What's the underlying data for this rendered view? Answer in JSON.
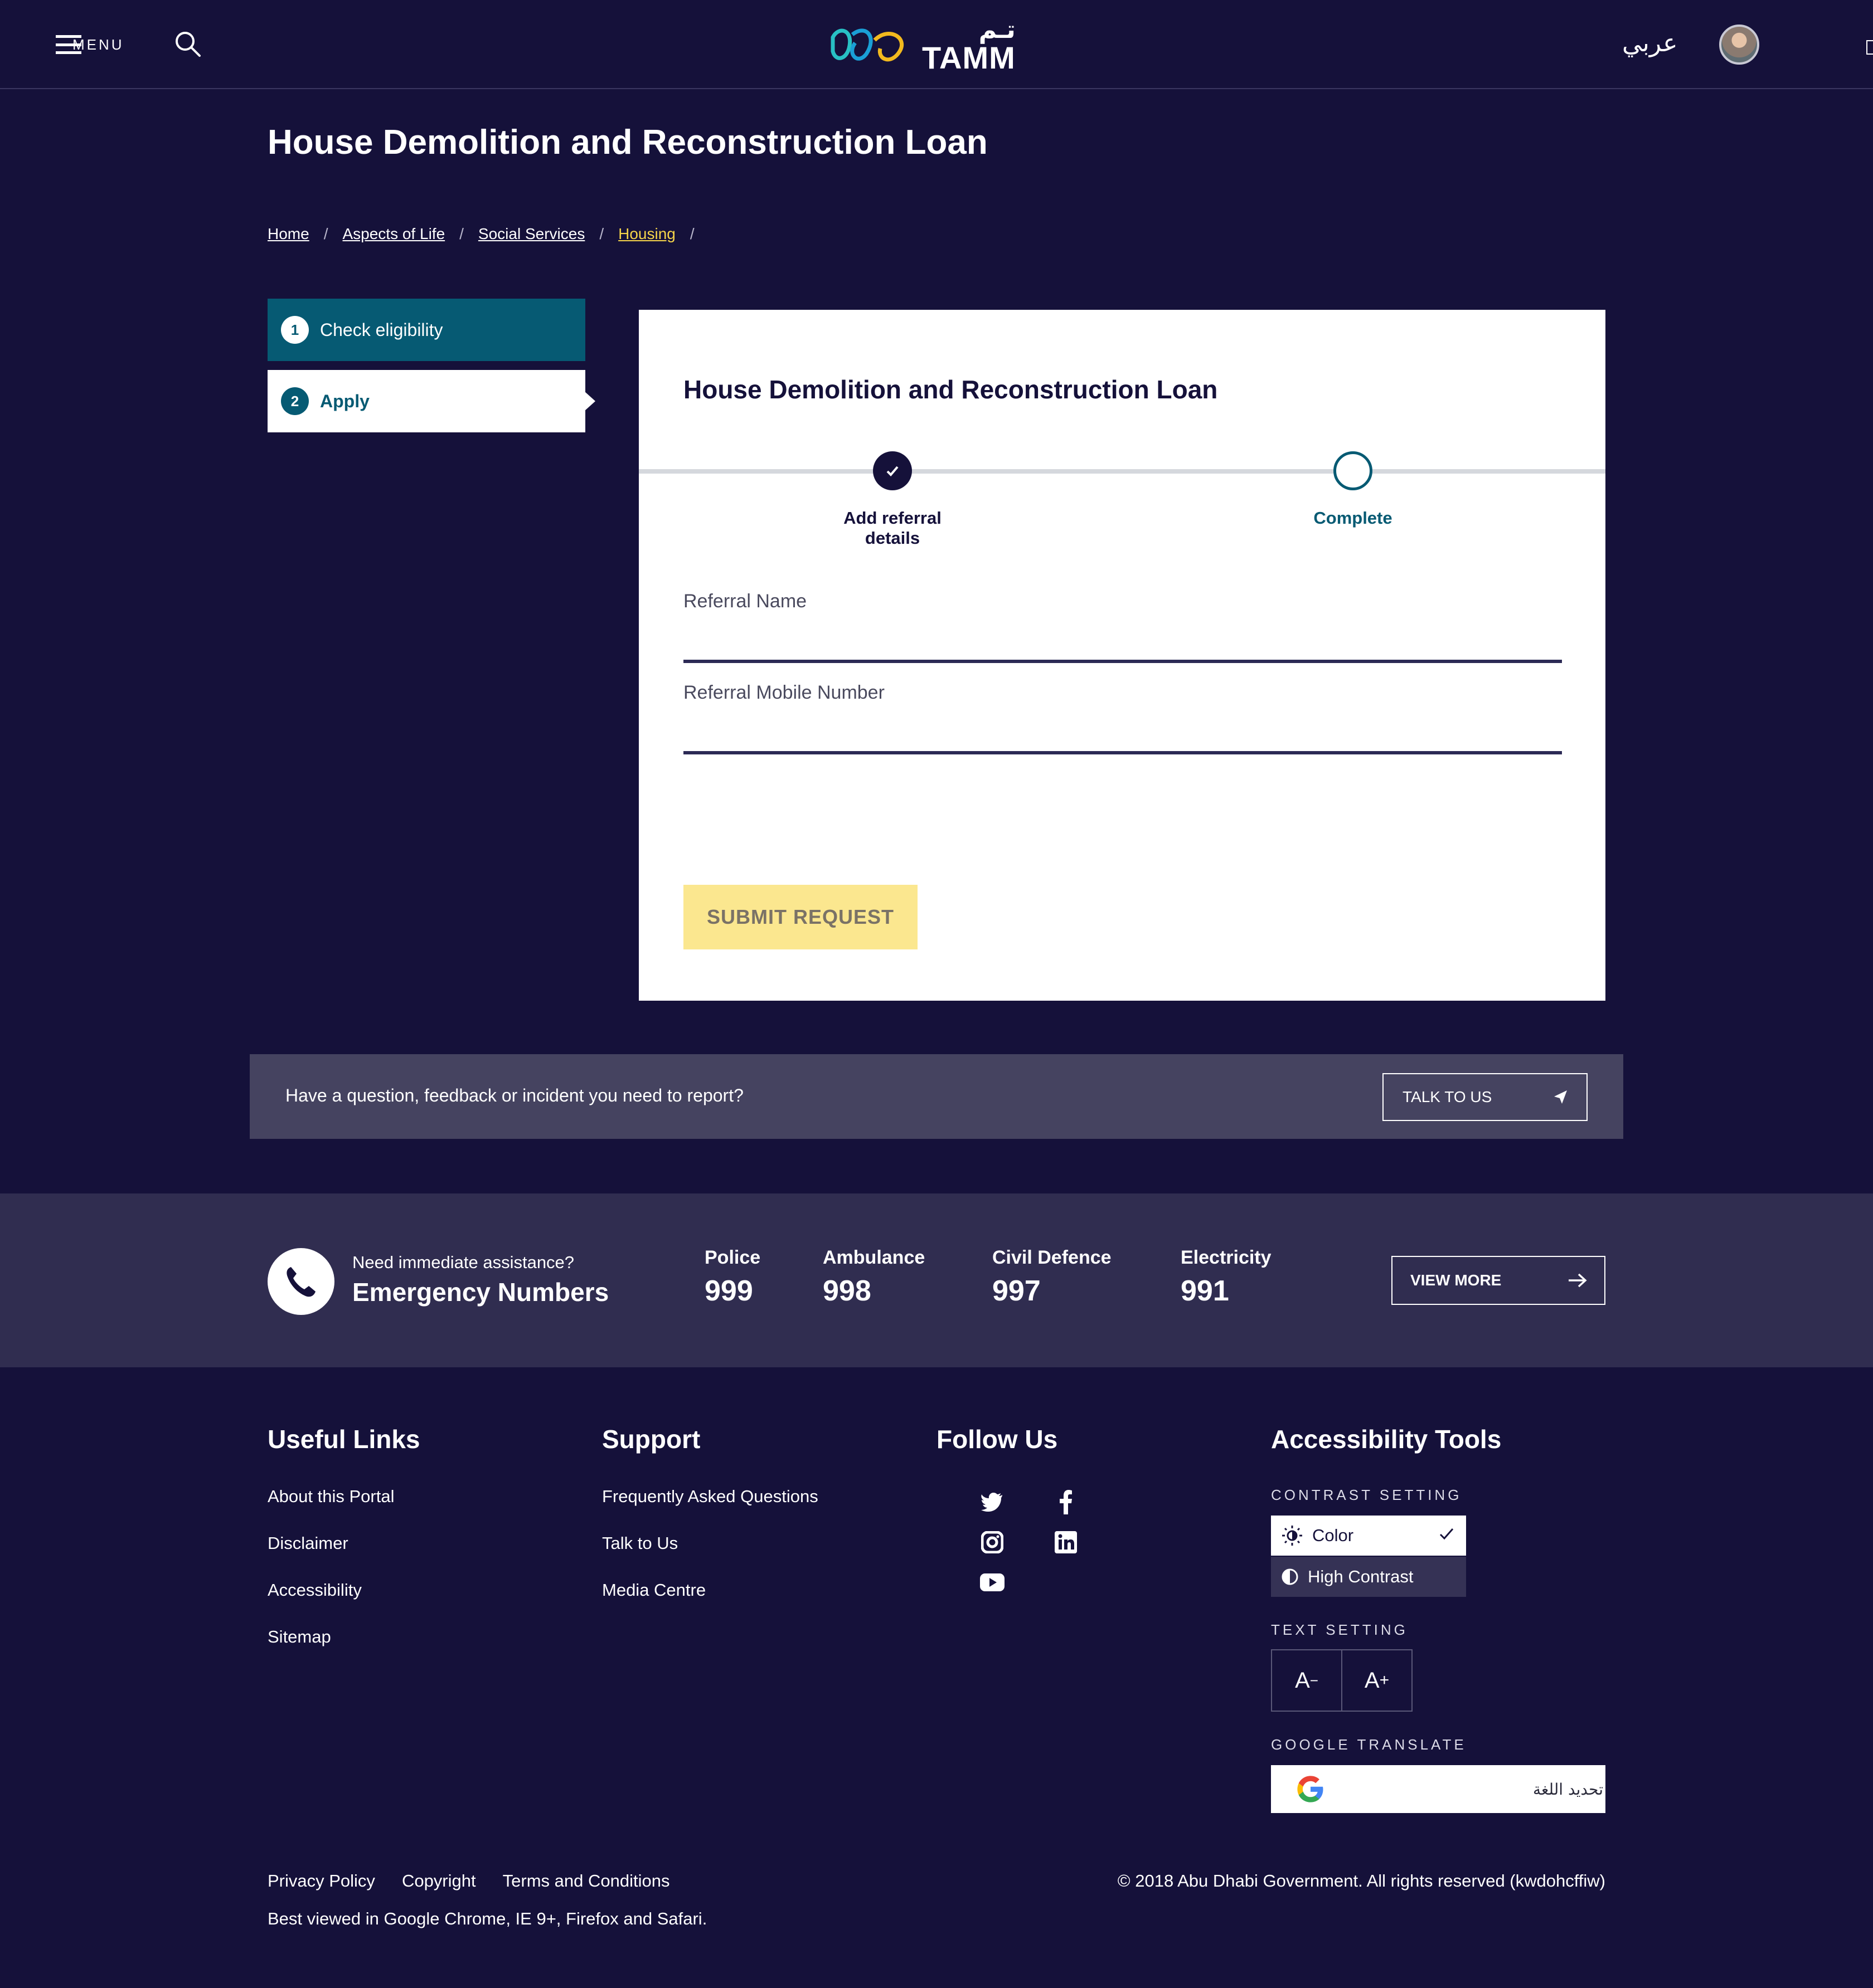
{
  "header": {
    "menu_label": "MENU",
    "logo_text": "TAMM",
    "logo_arabic": "تـم",
    "language_link": "عربي"
  },
  "page": {
    "title": "House Demolition and Reconstruction Loan"
  },
  "breadcrumb": [
    {
      "label": "Home"
    },
    {
      "label": "Aspects of Life"
    },
    {
      "label": "Social Services"
    },
    {
      "label": "Housing"
    }
  ],
  "breadcrumb_separator": "/",
  "steps": [
    {
      "number": "1",
      "label": "Check eligibility",
      "state": "completed"
    },
    {
      "number": "2",
      "label": "Apply",
      "state": "current"
    }
  ],
  "form": {
    "title": "House Demolition and Reconstruction Loan",
    "progress": [
      {
        "label": "Add referral details",
        "state": "done"
      },
      {
        "label": "Complete",
        "state": "pending"
      }
    ],
    "fields": [
      {
        "label": "Referral Name",
        "value": ""
      },
      {
        "label": "Referral Mobile Number",
        "value": ""
      }
    ],
    "submit_label": "SUBMIT REQUEST"
  },
  "question_band": {
    "text": "Have a question, feedback or incident you need to report?",
    "button_label": "TALK TO US"
  },
  "emergency": {
    "subtitle": "Need immediate assistance?",
    "title": "Emergency Numbers",
    "numbers": [
      {
        "label": "Police",
        "value": "999"
      },
      {
        "label": "Ambulance",
        "value": "998"
      },
      {
        "label": "Civil Defence",
        "value": "997"
      },
      {
        "label": "Electricity",
        "value": "991"
      }
    ],
    "view_more_label": "VIEW MORE"
  },
  "footer": {
    "useful_links": {
      "title": "Useful Links",
      "items": [
        "About this Portal",
        "Disclaimer",
        "Accessibility",
        "Sitemap"
      ]
    },
    "support": {
      "title": "Support",
      "items": [
        "Frequently Asked Questions",
        "Talk to Us",
        "Media Centre"
      ]
    },
    "follow_us": {
      "title": "Follow Us",
      "icons": [
        "twitter-icon",
        "facebook-icon",
        "instagram-icon",
        "linkedin-icon",
        "youtube-icon"
      ]
    },
    "accessibility": {
      "title": "Accessibility Tools",
      "contrast_label": "CONTRAST SETTING",
      "contrast_options": [
        {
          "label": "Color",
          "selected": true
        },
        {
          "label": "High Contrast",
          "selected": false
        }
      ],
      "text_label": "TEXT SETTING",
      "text_decrease": "A",
      "text_decrease_sup": "−",
      "text_increase": "A",
      "text_increase_sup": "+",
      "translate_label": "GOOGLE TRANSLATE",
      "translate_value": "تحديد اللغة"
    },
    "bottom_links": [
      "Privacy Policy",
      "Copyright",
      "Terms and Conditions"
    ],
    "best_viewed": "Best viewed in Google Chrome, IE 9+, Firefox and Safari.",
    "copyright": "© 2018 Abu Dhabi Government. All rights reserved (kwdohcffiw)"
  },
  "colors": {
    "background": "#15113a",
    "teal": "#065a73",
    "yellow_link": "#f5d44a",
    "submit_bg": "#fbe78f",
    "band": "#454360",
    "emergency_bg": "#302d50"
  }
}
